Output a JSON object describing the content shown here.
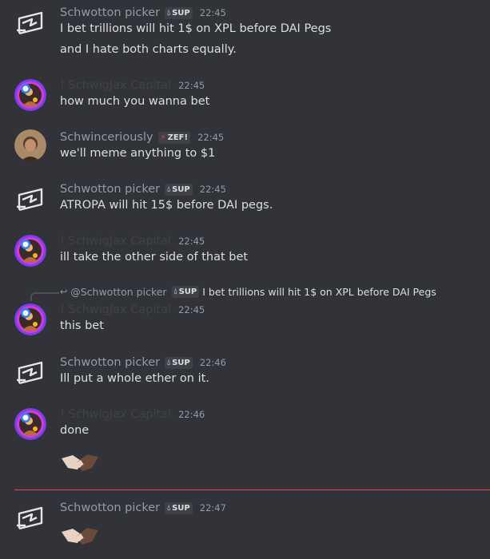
{
  "messages": [
    {
      "author": "Schwotton picker",
      "tag": "SUP",
      "time": "22:45",
      "lines": [
        "I bet trillions will hit 1$ on XPL before DAI Pegs",
        "and I hate both charts equally."
      ]
    },
    {
      "author": "! SchwigJax Capital",
      "time": "22:45",
      "lines": [
        "how much you wanna bet"
      ]
    },
    {
      "author": "Schwinceriously",
      "tag": "ZEF!",
      "time": "22:45",
      "lines": [
        "we'll meme anything to $1"
      ]
    },
    {
      "author": "Schwotton picker",
      "tag": "SUP",
      "time": "22:45",
      "lines": [
        "ATROPA will hit 15$ before DAI pegs."
      ]
    },
    {
      "author": "! SchwigJax Capital",
      "time": "22:45",
      "lines": [
        "ill take the other side of that bet"
      ]
    },
    {
      "author": "! SchwigJax Capital",
      "time": "22:45",
      "lines": [
        "this bet"
      ]
    },
    {
      "author": "Schwotton picker",
      "tag": "SUP",
      "time": "22:46",
      "lines": [
        "Ill put a whole ether on it."
      ]
    },
    {
      "author": "! SchwigJax Capital",
      "time": "22:46",
      "lines": [
        "done"
      ]
    },
    {
      "author": "Schwotton picker",
      "tag": "SUP",
      "time": "22:47",
      "lines": []
    }
  ],
  "reply": {
    "author": "@Schwotton picker",
    "tag": "SUP",
    "text": "I bet trillions will hit 1$ on XPL before DAI Pegs"
  },
  "emoji": {
    "name": "handshake-emoji"
  },
  "colors": {
    "background": "#313338",
    "divider": "#f23f43",
    "muted": "#949ba4",
    "text": "#dbdee1"
  }
}
